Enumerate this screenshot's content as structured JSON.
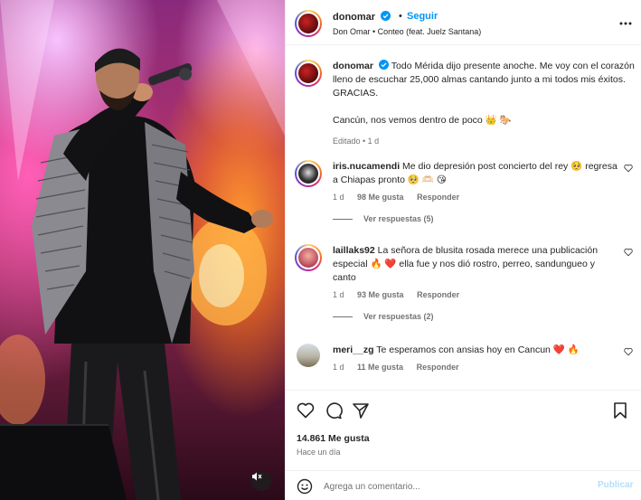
{
  "post": {
    "username": "donomar",
    "follow_label": "Seguir",
    "separator": "•",
    "audio": "Don Omar • Conteo (feat. Juelz Santana)",
    "caption_p1": "Todo Mérida dijo presente anoche. Me voy con el corazón lleno de escuchar 25,000 almas cantando junto a mi todos mis éxitos. GRACIAS.",
    "caption_p2": "Cancún, nos vemos dentro de poco 👑 🐎",
    "caption_meta": "Editado • 1 d",
    "likes": "14.861 Me gusta",
    "time_ago": "Hace un día"
  },
  "comments": [
    {
      "username": "iris.nucamendi",
      "text": "Me dio depresión post concierto del rey 🥺 regresa a Chiapas pronto 🥺 🫶🏻 😘",
      "age": "1 d",
      "likes": "98 Me gusta",
      "reply_label": "Responder",
      "view_replies": "Ver respuestas (5)"
    },
    {
      "username": "laillaks92",
      "text": "La señora de blusita rosada merece una publicación especial 🔥 ❤️ ella fue y nos dió rostro, perreo, sandungueo y canto",
      "age": "1 d",
      "likes": "93 Me gusta",
      "reply_label": "Responder",
      "view_replies": "Ver respuestas (2)"
    },
    {
      "username": "meri__zg",
      "text": "Te esperamos con ansias hoy en Cancun ❤️ 🔥",
      "age": "1 d",
      "likes": "11 Me gusta",
      "reply_label": "Responder"
    }
  ],
  "composer": {
    "placeholder": "Agrega un comentario...",
    "post_label": "Publicar"
  },
  "icons": {
    "verified": "verified-badge-icon",
    "more": "more-options-icon",
    "like": "heart-icon",
    "comment": "comment-bubble-icon",
    "share": "paper-plane-icon",
    "save": "bookmark-icon",
    "emoji": "emoji-icon",
    "audio": "speaker-muted-icon"
  },
  "colors": {
    "accent": "#0095f6",
    "verified": "#0095f6",
    "text": "#262626",
    "secondary": "#737373"
  }
}
